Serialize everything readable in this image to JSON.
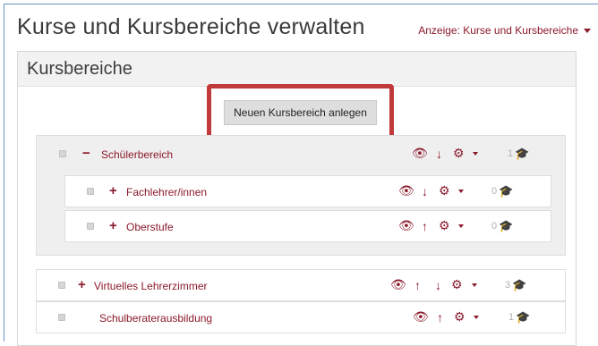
{
  "page": {
    "title": "Kurse und Kursbereiche verwalten",
    "view_label": "Anzeige: Kurse und Kursbereiche"
  },
  "panel": {
    "title": "Kursbereiche",
    "new_button": "Neuen Kursbereich anlegen"
  },
  "categories": [
    {
      "label": "Schülerbereich",
      "expander": "−",
      "count": "1"
    },
    {
      "label": "Fachlehrer/innen",
      "expander": "+",
      "count": "0"
    },
    {
      "label": "Oberstufe",
      "expander": "+",
      "count": "0"
    },
    {
      "label": "Virtuelles Lehrerzimmer",
      "expander": "+",
      "count": "3"
    },
    {
      "label": "Schulberaterausbildung",
      "expander": "",
      "count": "1"
    }
  ],
  "icons": {
    "eye": "👁",
    "up": "↑",
    "down": "↓",
    "gear": "⚙",
    "hat": "🎓"
  },
  "colors": {
    "accent": "#8b1a2b",
    "highlight_border": "#c0393b",
    "muted": "#b0b0b0"
  }
}
